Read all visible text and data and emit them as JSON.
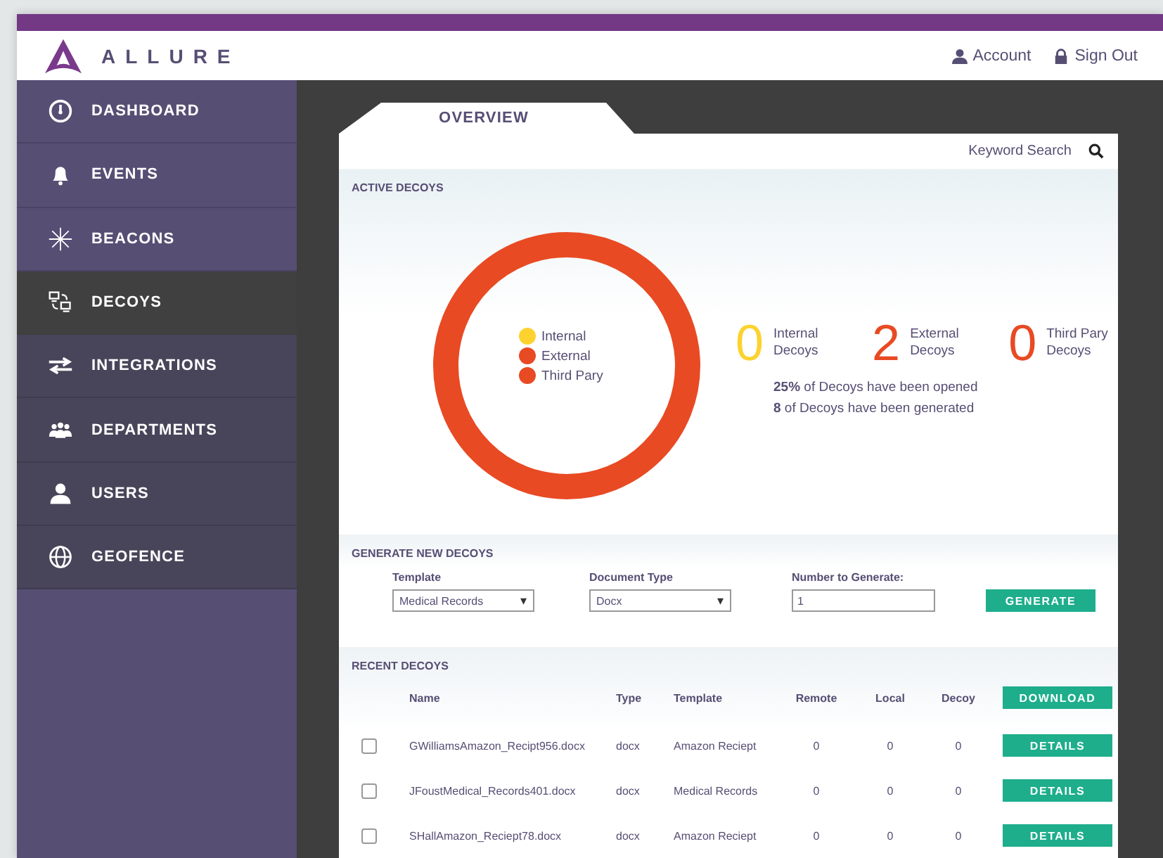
{
  "header": {
    "logo": "ALLURE",
    "links": [
      {
        "kind": "account",
        "label": "Account"
      },
      {
        "kind": "lock",
        "label": "Sign Out"
      }
    ]
  },
  "sidebar": {
    "items": [
      {
        "label": "DASHBOARD",
        "selected": false
      },
      {
        "label": "EVENTS",
        "selected": false
      },
      {
        "label": "BEACONS",
        "selected": false
      },
      {
        "label": "DECOYS",
        "selected": true
      },
      {
        "label": "INTEGRATIONS",
        "selected": false
      },
      {
        "label": "DEPARTMENTS",
        "selected": false
      },
      {
        "label": "USERS",
        "selected": false
      },
      {
        "label": "GEOFENCE",
        "selected": false
      }
    ]
  },
  "tab": {
    "label": "OVERVIEW"
  },
  "search": {
    "label": "Keyword Search"
  },
  "active_decoys": {
    "title": "ACTIVE DECOYS",
    "legend": [
      {
        "label": "Internal",
        "color": "#fdd22f"
      },
      {
        "label": "External",
        "color": "#e84a23"
      },
      {
        "label": "Third Pary",
        "color": "#e84a23"
      }
    ],
    "stats": [
      {
        "count": "0",
        "label": "Internal Decoys",
        "color": "#fdd22f"
      },
      {
        "count": "2",
        "label": "External Decoys",
        "color": "#e84a23"
      },
      {
        "count": "0",
        "label": "Third Pary Decoys",
        "color": "#e84a23"
      }
    ],
    "notes": [
      "**25%** of Decoys have been opened",
      "**8** of Decoys have been generated"
    ]
  },
  "generate": {
    "title": "GENERATE NEW DECOYS",
    "template_label": "Template",
    "template_value": "Medical Records",
    "doctype_label": "Document Type",
    "doctype_value": "Docx",
    "number_label": "Number to Generate:",
    "number_value": "1",
    "caret": "▾",
    "button": "GENERATE"
  },
  "recent": {
    "title": "RECENT DECOYS",
    "columns": [
      "Name",
      "Type",
      "Template",
      "Remote",
      "Local",
      "Decoy"
    ],
    "download": "DOWNLOAD",
    "rows": [
      {
        "checked": false,
        "name": "GWilliamsAmazon_Recipt956.docx",
        "type": "docx",
        "template": "Amazon Reciept",
        "remote": "0",
        "local": "0",
        "decoy": "0",
        "button": "DETAILS"
      },
      {
        "checked": false,
        "name": "JFoustMedical_Records401.docx",
        "type": "docx",
        "template": "Medical Records",
        "remote": "0",
        "local": "0",
        "decoy": "0",
        "button": "DETAILS"
      },
      {
        "checked": false,
        "name": "SHallAmazon_Reciept78.docx",
        "type": "docx",
        "template": "Amazon Reciept",
        "remote": "0",
        "local": "0",
        "decoy": "0",
        "button": "DETAILS"
      }
    ]
  }
}
